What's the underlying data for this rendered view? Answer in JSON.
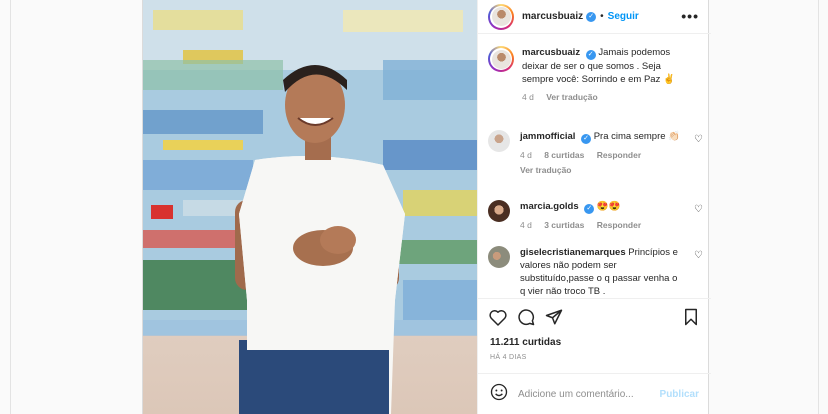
{
  "post": {
    "username": "marcusbuaiz",
    "follow_label": "Seguir",
    "more_label": "•••",
    "caption": {
      "username": "marcusbuaiz",
      "text": "Jamais podemos deixar de ser o que somos . Seja sempre você: Sorrindo e em Paz ✌️",
      "time": "4 d",
      "translate": "Ver tradução"
    },
    "comments": [
      {
        "username": "jammofficial",
        "text": "Pra cima sempre 👏🏻",
        "time": "4 d",
        "likes": "8 curtidas",
        "reply": "Responder",
        "translate": "Ver tradução"
      },
      {
        "username": "marcia.golds",
        "text": "😍😍",
        "time": "4 d",
        "likes": "3 curtidas",
        "reply": "Responder"
      },
      {
        "username": "giselecristianemarques",
        "text": "Princípios e valores não podem ser substituído,passe o q passar venha o q vier não troco TB ."
      }
    ],
    "likes_count": "11.211 curtidas",
    "time_ago": "HÁ 4 DIAS",
    "add_comment_placeholder": "Adicione um comentário...",
    "publish_label": "Publicar"
  },
  "colors": {
    "link_blue": "#0095f6",
    "publish_disabled": "#b2dffc",
    "verified": "#3897f0"
  }
}
